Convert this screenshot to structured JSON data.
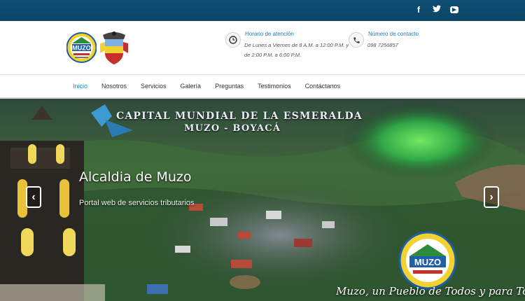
{
  "topbar": {
    "social": [
      {
        "icon": "facebook-icon",
        "glyph": "f"
      },
      {
        "icon": "twitter-icon",
        "glyph": "🐦"
      },
      {
        "icon": "youtube-icon",
        "glyph": "▶"
      }
    ]
  },
  "header": {
    "logo_text": "MUZO",
    "hours": {
      "title": "Horario de atención",
      "line1": "De Lunes a Viernes de 8 A.M. a 12:00 P.M. y",
      "line2": "de 2:00 P.M. a 6:00 P.M."
    },
    "contact": {
      "title": "Número de contacto",
      "phone": "098 7256857"
    }
  },
  "nav": {
    "items": [
      "Inicio",
      "Nosotros",
      "Servicios",
      "Galería",
      "Preguntas",
      "Testimonios",
      "Contáctanos"
    ],
    "active": "Inicio"
  },
  "hero": {
    "banner_line1": "CAPITAL MUNDIAL DE LA ESMERALDA",
    "banner_line2": "MUZO - BOYACÁ",
    "title": "Alcaldia de Muzo",
    "subtitle": "Portal web de servicios tributarios",
    "slogan": "Muzo, un Pueblo de Todos y para Todos",
    "prev_glyph": "‹",
    "next_glyph": "›"
  },
  "colors": {
    "topbar": "#0a4566",
    "accent": "#1b84c4"
  }
}
